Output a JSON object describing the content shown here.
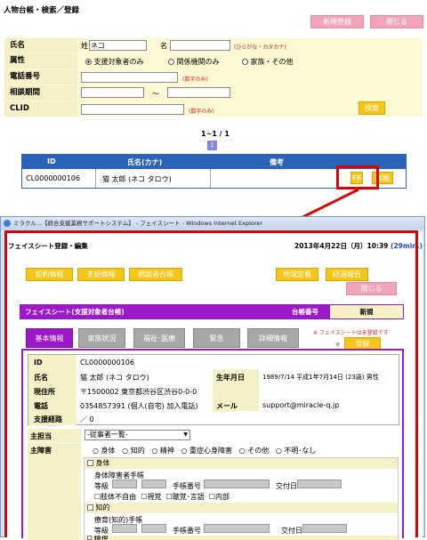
{
  "top": {
    "title": "人物台帳・検索／登録",
    "new_btn": "新規登録",
    "close_btn": "閉じる",
    "form": {
      "name_label": "氏名",
      "sei_label": "姓",
      "sei_value": "ネコ",
      "mei_label": "名",
      "mei_value": "",
      "name_hint": "(ひらがな・カタカナ)",
      "attr_label": "属性",
      "attr_options": [
        "支援対象者のみ",
        "関係機関のみ",
        "家族・その他"
      ],
      "phone_label": "電話番号",
      "phone_hint": "(数字のみ)",
      "period_label": "相談期間",
      "tilde": "～",
      "clid_label": "CLID",
      "clid_hint": "(数字のみ)",
      "search_btn": "検索"
    },
    "pager": {
      "range": "1~1 / 1",
      "page": "1"
    },
    "table": {
      "headers": [
        "ID",
        "氏名(カナ)",
        "備考"
      ],
      "row": {
        "id": "CL0000000106",
        "name": "猫 太郎 (ネコ タロウ)",
        "note": "",
        "fs_btn": "FS",
        "detail_btn": "詳細"
      }
    }
  },
  "window": {
    "titlebar": "ミラクル...【統合支援業務サポートシステム】 - フェイスシート - Windows Internet Explorer",
    "page_title": "フェイスシート登録・編集",
    "datetime": "2013年4月22日（月）10:39",
    "remaining": "(29min.)",
    "nav": [
      "契約情報",
      "支給情報",
      "相談者台帳"
    ],
    "nav_right": [
      "地域定着",
      "経過報告"
    ],
    "close_btn": "閉じる",
    "sheet_title": "フェイスシート(支援対象者台帳)",
    "ledger_label": "台帳番号",
    "ledger_value": "新規",
    "tabs": [
      "基本情報",
      "家族状況",
      "福祉･医療",
      "緊急",
      "詳細情報"
    ],
    "unregistered_note": "※ フェイスシートは未登録です",
    "register_mark": "※",
    "register_btn": "登録",
    "info": {
      "id_label": "ID",
      "id_value": "CL0000000106",
      "name_label": "氏名",
      "name_value": "猫 太郎 (ネコ タロウ)",
      "birth_label": "生年月日",
      "birth_value": "1989/7/14  平成1年7月14日 (23歳)  男性",
      "addr_label": "現住所",
      "addr_value": "〒1500002  東京都渋谷区渋谷0-0-0",
      "phone_label": "電話",
      "phone_value": "0354857391 (個人(自宅) 加入電話)",
      "mail_label": "メール",
      "mail_value": "support@miracle-q.jp",
      "route_label": "支援経路",
      "route_value": "／  0"
    },
    "staff_label": "主担当",
    "staff_select": "-従事者一覧-",
    "disability_label": "主障害",
    "disability_options": [
      "身体",
      "知的",
      "精神",
      "重症心身障害",
      "その他",
      "不明･なし"
    ],
    "body": {
      "section": "身体",
      "handbook": "身体障害者手帳",
      "grade": "等級",
      "number": "手帳番号",
      "issued": "交付日",
      "checks": [
        "肢体不自由",
        "視覚",
        "聴覚･言語",
        "内部"
      ]
    },
    "intel": {
      "section": "知的",
      "handbook": "療育(知的)手帳",
      "grade": "等級",
      "number": "手帳番号",
      "issued": "交付日"
    },
    "mental": {
      "section": "精神"
    }
  },
  "colors": {
    "header_blue": "#2a63b7",
    "purple": "#9b19c9",
    "pink": "#f2a4b8",
    "yellow": "#f5c518",
    "beige": "#f6f0c6",
    "red_frame": "#e00000"
  }
}
